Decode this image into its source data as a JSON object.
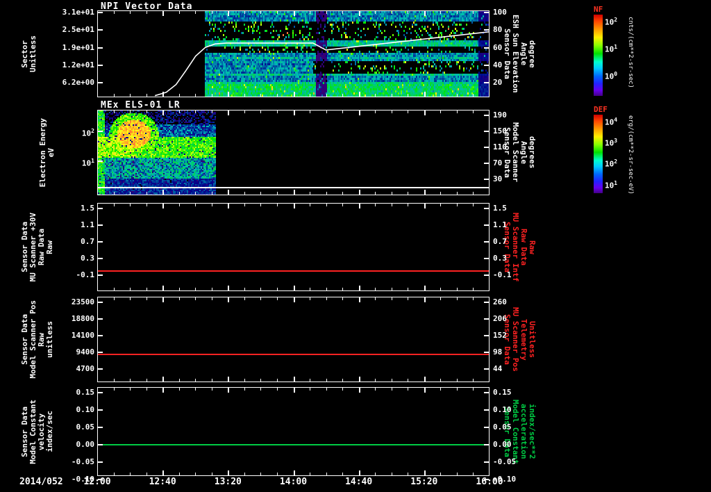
{
  "meta": {
    "background": "#000000",
    "axis_color": "#ffffff",
    "red": "#ff2222",
    "green": "#00cc44"
  },
  "time_axis": {
    "date": "2014/052",
    "ticks": [
      "12:00",
      "12:40",
      "13:20",
      "14:00",
      "14:40",
      "15:20",
      "16:00"
    ]
  },
  "panels": [
    {
      "key": "npi",
      "title": "NPI Vector Data",
      "left_label": [
        "Sector",
        "Unitless"
      ],
      "left_ticks": [
        "3.1e+01",
        "2.5e+01",
        "1.9e+01",
        "1.2e+01",
        "6.2e+00"
      ],
      "right_ticks": [
        "100",
        "80",
        "60",
        "40",
        "20"
      ],
      "right_label": [
        "Sensor Data",
        "ESH Sun Elevation",
        "Angle",
        "degree"
      ],
      "right_label_color": "#ffffff"
    },
    {
      "key": "els",
      "title": "MEx ELS-01 LR",
      "left_label": [
        "Electron Energy",
        "eV"
      ],
      "left_ticks": [
        "10^2",
        "10^1"
      ],
      "right_ticks": [
        "190",
        "150",
        "110",
        "70",
        "30"
      ],
      "right_label": [
        "Sensor Data",
        "Model Scanner",
        "Angle",
        "degrees"
      ],
      "right_label_color": "#ffffff"
    },
    {
      "key": "mu-scanner-30v",
      "left_label": [
        "Sensor Data",
        "MU Scanner +30V",
        "Raw Data",
        "Raw"
      ],
      "left_ticks": [
        "1.5",
        "1.1",
        "0.7",
        "0.3",
        "-0.1"
      ],
      "right_ticks": [
        "1.5",
        "1.1",
        "0.7",
        "0.3",
        "-0.1"
      ],
      "right_label": [
        "Sensor Data",
        "MU Scanner Intf",
        "Raw Data",
        "Raw"
      ],
      "right_label_color": "#ff2222"
    },
    {
      "key": "scanner-pos",
      "left_label": [
        "Sensor Data",
        "Model Scanner Pos",
        "Raw",
        "unitless"
      ],
      "left_ticks": [
        "23500",
        "18800",
        "14100",
        "9400",
        "4700"
      ],
      "right_ticks": [
        "260",
        "206",
        "152",
        "98",
        "44"
      ],
      "right_label": [
        "Sensor Data",
        "MU Scanner Pos",
        "Telemetry",
        "Unitless"
      ],
      "right_label_color": "#ff2222"
    },
    {
      "key": "model-constant",
      "left_label": [
        "Sensor Data",
        "Model Constant",
        "velocity",
        "index/sec"
      ],
      "left_ticks": [
        "0.15",
        "0.10",
        "0.05",
        "0.00",
        "-0.05",
        "-0.10"
      ],
      "right_ticks": [
        "0.15",
        "0.10",
        "0.05",
        "0.00",
        "-0.05",
        "-0.10"
      ],
      "right_label": [
        "Sensor Data",
        "Model Constant",
        "acceleration",
        "index/sec**2"
      ],
      "right_label_color": "#00cc44"
    }
  ],
  "colorbars": [
    {
      "name": "NF",
      "ticks": [
        "10^2",
        "10^1",
        "10^0"
      ],
      "unit": "cnts/(cm**2-sr-sec)"
    },
    {
      "name": "DEF",
      "ticks": [
        "10^4",
        "10^3",
        "10^2",
        "10^1"
      ],
      "unit": "erg/(cm**2-sr-sec-eV)"
    }
  ],
  "chart_data": [
    {
      "panel": "NPI Vector Data",
      "type": "heatmap",
      "x_range": [
        "2014/052 12:00",
        "2014/052 16:00"
      ],
      "x_ticks": [
        "12:00",
        "12:40",
        "13:20",
        "14:00",
        "14:40",
        "15:20",
        "16:00"
      ],
      "y_axis_left": {
        "label": "Sector Unitless",
        "ticks": [
          31,
          25,
          19,
          12,
          6.2
        ]
      },
      "y_axis_right": {
        "label": "Sensor Data ESH Sun Elevation Angle degree",
        "ticks": [
          100,
          80,
          60,
          40,
          20
        ]
      },
      "colorbar": {
        "label": "NF",
        "unit": "cnts/(cm**2-sr-sec)",
        "log_ticks": [
          100,
          10,
          1
        ]
      },
      "heatmap_note": "Blue-dominated count-rate spectrogram starting ~13:05, black dropout bands across several sector rows, vertical data gap near 14:15, darker at right edge",
      "overlay_line": {
        "name": "ESH Sun Elevation Angle (deg)",
        "points_min_after_1200_vs_deg": [
          [
            35,
            4
          ],
          [
            42,
            8
          ],
          [
            48,
            17
          ],
          [
            54,
            33
          ],
          [
            60,
            50
          ],
          [
            66,
            60
          ],
          [
            72,
            64
          ],
          [
            79,
            65
          ],
          [
            132,
            65
          ],
          [
            136,
            61
          ],
          [
            140,
            57
          ],
          [
            240,
            78
          ]
        ]
      }
    },
    {
      "panel": "MEx ELS-01 LR",
      "type": "heatmap",
      "y_axis_left": {
        "label": "Electron Energy eV",
        "scale": "log",
        "ticks": [
          100,
          10
        ]
      },
      "y_axis_right": {
        "label": "Sensor Data Model Scanner Angle degrees",
        "ticks": [
          190,
          150,
          110,
          70,
          30
        ]
      },
      "colorbar": {
        "label": "DEF",
        "unit": "erg/(cm**2-sr-sec-eV)",
        "log_ticks": [
          10000,
          1000,
          100,
          10
        ]
      },
      "heatmap_note": "Electron energy-flux spectrogram present only from 12:00 to ~13:10; intense red enhancement ~12:15-12:30 between ~30-150 eV above a persistent green band near 10-40 eV; black (no data) afterwards",
      "overlay_line": {
        "name": "Model Scanner Angle (deg)",
        "constant_value": 10
      }
    },
    {
      "panel": "MU Scanner +30V Raw",
      "type": "line",
      "series": [
        {
          "name": "Sensor Data MU Scanner Intf Raw Data Raw",
          "color": "#ff2222",
          "constant_value": 0.0
        }
      ],
      "y_ticks": [
        1.5,
        1.1,
        0.7,
        0.3,
        -0.1
      ]
    },
    {
      "panel": "Model Scanner Pos Raw",
      "type": "line",
      "series": [
        {
          "name": "Sensor Data MU Scanner Pos Telemetry",
          "color": "#ff2222",
          "constant_value": 8800
        }
      ],
      "y_ticks_left": [
        23500,
        18800,
        14100,
        9400,
        4700
      ],
      "y_ticks_right": [
        260,
        206,
        152,
        98,
        44
      ]
    },
    {
      "panel": "Model Constant velocity",
      "type": "line",
      "series": [
        {
          "name": "Sensor Data Model Constant acceleration",
          "color": "#00cc44",
          "constant_value": 0.0
        }
      ],
      "y_ticks": [
        0.15,
        0.1,
        0.05,
        0.0,
        -0.05,
        -0.1
      ]
    }
  ]
}
